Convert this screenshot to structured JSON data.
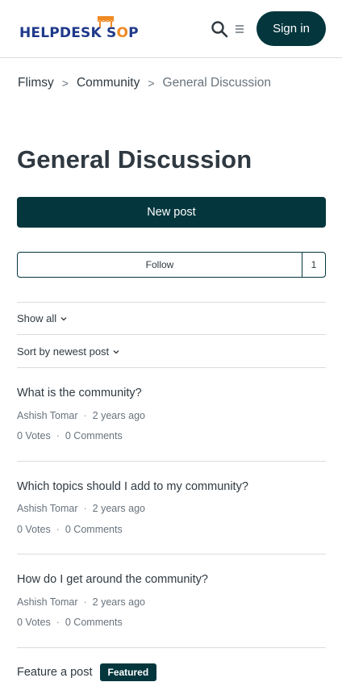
{
  "header": {
    "logo_text_a": "HELPDESK S",
    "logo_text_o": "O",
    "logo_text_b": "P",
    "logo_full": "HELPDESK SHOP",
    "signin_label": "Sign in",
    "search_icon": "search-icon",
    "menu_icon": "hamburger-menu-icon"
  },
  "breadcrumb": {
    "items": [
      "Flimsy",
      "Community",
      "General Discussion"
    ],
    "separator": ">"
  },
  "page": {
    "title": "General Discussion",
    "new_post_label": "New post",
    "follow_label": "Follow",
    "follow_count": "1"
  },
  "filters": {
    "show_label": "Show all",
    "sort_label": "Sort by newest post"
  },
  "posts": [
    {
      "title": "What is the community?",
      "author": "Ashish Tomar",
      "time": "2 years ago",
      "votes": "0 Votes",
      "comments": "0 Comments"
    },
    {
      "title": "Which topics should I add to my community?",
      "author": "Ashish Tomar",
      "time": "2 years ago",
      "votes": "0 Votes",
      "comments": "0 Comments"
    },
    {
      "title": "How do I get around the community?",
      "author": "Ashish Tomar",
      "time": "2 years ago",
      "votes": "0 Votes",
      "comments": "0 Comments"
    },
    {
      "title": "Feature a post",
      "badge": "Featured"
    }
  ],
  "colors": {
    "primary": "#03363d",
    "logo_blue": "#1f3a8a",
    "logo_orange": "#f08a24",
    "text": "#2f3941",
    "muted": "#68737d",
    "border": "#d8dcde"
  }
}
